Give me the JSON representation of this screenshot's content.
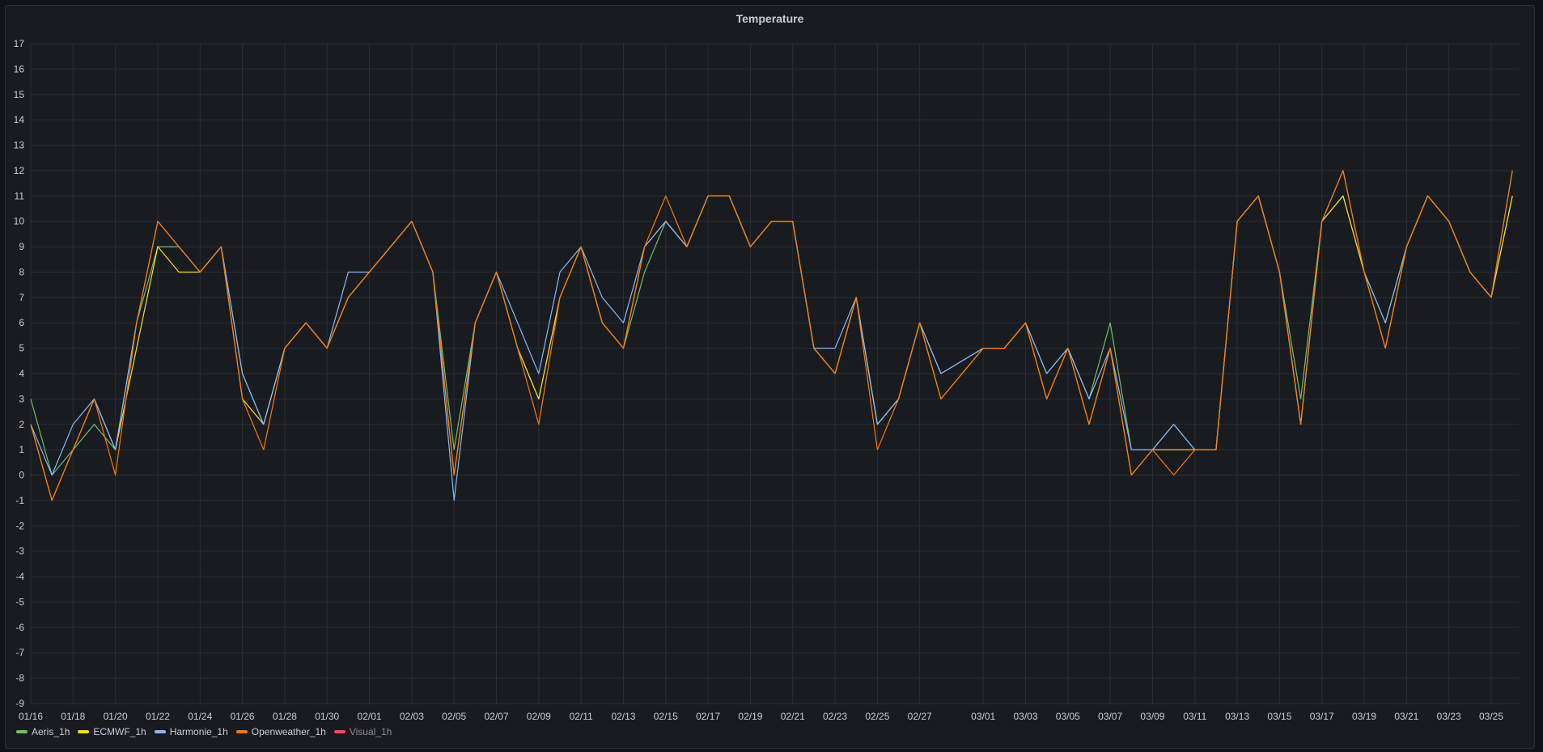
{
  "panel": {
    "title": "Temperature"
  },
  "chart_data": {
    "type": "line",
    "title": "Temperature",
    "ylim": [
      -9,
      17
    ],
    "yticks": [
      17,
      16,
      15,
      14,
      13,
      12,
      11,
      10,
      9,
      8,
      7,
      6,
      5,
      4,
      3,
      2,
      1,
      0,
      -1,
      -2,
      -3,
      -4,
      -5,
      -6,
      -7,
      -8,
      -9
    ],
    "xlim": [
      "01/16",
      "03/26"
    ],
    "xtick_labels": [
      "01/16",
      "01/18",
      "01/20",
      "01/22",
      "01/24",
      "01/26",
      "01/28",
      "01/30",
      "02/01",
      "02/03",
      "02/05",
      "02/07",
      "02/09",
      "02/11",
      "02/13",
      "02/15",
      "02/17",
      "02/19",
      "02/21",
      "02/23",
      "02/25",
      "02/27",
      "03/01",
      "03/03",
      "03/05",
      "03/07",
      "03/09",
      "03/11",
      "03/13",
      "03/15",
      "03/17",
      "03/19",
      "03/21",
      "03/23",
      "03/25"
    ],
    "grid": true,
    "legend_position": "bottom-left",
    "x": [
      "01/16",
      "01/17",
      "01/18",
      "01/19",
      "01/20",
      "01/21",
      "01/22",
      "01/23",
      "01/24",
      "01/25",
      "01/26",
      "01/27",
      "01/28",
      "01/29",
      "01/30",
      "01/31",
      "02/01",
      "02/02",
      "02/03",
      "02/04",
      "02/05",
      "02/06",
      "02/07",
      "02/08",
      "02/09",
      "02/10",
      "02/11",
      "02/12",
      "02/13",
      "02/14",
      "02/15",
      "02/16",
      "02/17",
      "02/18",
      "02/19",
      "02/20",
      "02/21",
      "02/22",
      "02/23",
      "02/24",
      "02/25",
      "02/26",
      "02/27",
      "02/28",
      "03/01",
      "03/02",
      "03/03",
      "03/04",
      "03/05",
      "03/06",
      "03/07",
      "03/08",
      "03/09",
      "03/10",
      "03/11",
      "03/12",
      "03/13",
      "03/14",
      "03/15",
      "03/16",
      "03/17",
      "03/18",
      "03/19",
      "03/20",
      "03/21",
      "03/22",
      "03/23",
      "03/24",
      "03/25",
      "03/26"
    ],
    "series": [
      {
        "name": "Aeris_1h",
        "color": "#73bf69",
        "visible": true,
        "values": [
          3,
          0,
          1,
          2,
          1,
          6,
          9,
          9,
          8,
          9,
          4,
          2,
          5,
          6,
          5,
          7,
          8,
          9,
          10,
          8,
          1,
          6,
          8,
          5,
          3,
          7,
          9,
          6,
          5,
          8,
          10,
          9,
          11,
          11,
          9,
          10,
          10,
          5,
          4,
          7,
          2,
          3,
          6,
          4,
          5,
          5,
          6,
          4,
          5,
          3,
          6,
          1,
          1,
          2,
          1,
          1,
          10,
          11,
          8,
          3,
          10,
          11,
          8,
          6,
          9,
          11,
          10,
          8,
          7,
          11
        ]
      },
      {
        "name": "ECMWF_1h",
        "color": "#fade2a",
        "visible": true,
        "values": [
          2,
          -1,
          1,
          3,
          1,
          5,
          9,
          8,
          8,
          9,
          3,
          2,
          5,
          6,
          5,
          7,
          8,
          9,
          10,
          8,
          0,
          6,
          8,
          5,
          3,
          7,
          9,
          6,
          5,
          9,
          10,
          9,
          11,
          11,
          9,
          10,
          10,
          5,
          4,
          7,
          2,
          3,
          6,
          3,
          5,
          5,
          6,
          3,
          5,
          2,
          5,
          0,
          1,
          1,
          1,
          1,
          10,
          11,
          8,
          2,
          10,
          11,
          8,
          5,
          9,
          11,
          10,
          8,
          7,
          11
        ]
      },
      {
        "name": "Harmonie_1h",
        "color": "#8ab8ff",
        "visible": true,
        "values": [
          2,
          0,
          2,
          3,
          1,
          6,
          10,
          9,
          8,
          9,
          4,
          2,
          5,
          6,
          5,
          8,
          8,
          9,
          10,
          8,
          -1,
          6,
          8,
          6,
          4,
          8,
          9,
          7,
          6,
          9,
          10,
          9,
          11,
          11,
          9,
          10,
          10,
          5,
          5,
          7,
          2,
          3,
          6,
          4,
          5,
          5,
          6,
          4,
          5,
          3,
          5,
          1,
          1,
          2,
          1,
          1,
          10,
          11,
          8,
          2,
          10,
          12,
          8,
          6,
          9,
          11,
          10,
          8,
          7,
          12
        ]
      },
      {
        "name": "Openweather_1h",
        "color": "#ff780a",
        "visible": true,
        "values": [
          2,
          -1,
          1,
          3,
          0,
          6,
          10,
          9,
          8,
          9,
          3,
          1,
          5,
          6,
          5,
          7,
          8,
          9,
          10,
          8,
          0,
          6,
          8,
          5,
          2,
          7,
          9,
          6,
          5,
          9,
          11,
          9,
          11,
          11,
          9,
          10,
          10,
          5,
          4,
          7,
          1,
          3,
          6,
          3,
          5,
          5,
          6,
          3,
          5,
          2,
          5,
          0,
          1,
          0,
          1,
          1,
          10,
          11,
          8,
          2,
          10,
          12,
          8,
          5,
          9,
          11,
          10,
          8,
          7,
          12
        ]
      },
      {
        "name": "Visual_1h",
        "color": "#f2495c",
        "visible": false,
        "values": []
      }
    ]
  }
}
